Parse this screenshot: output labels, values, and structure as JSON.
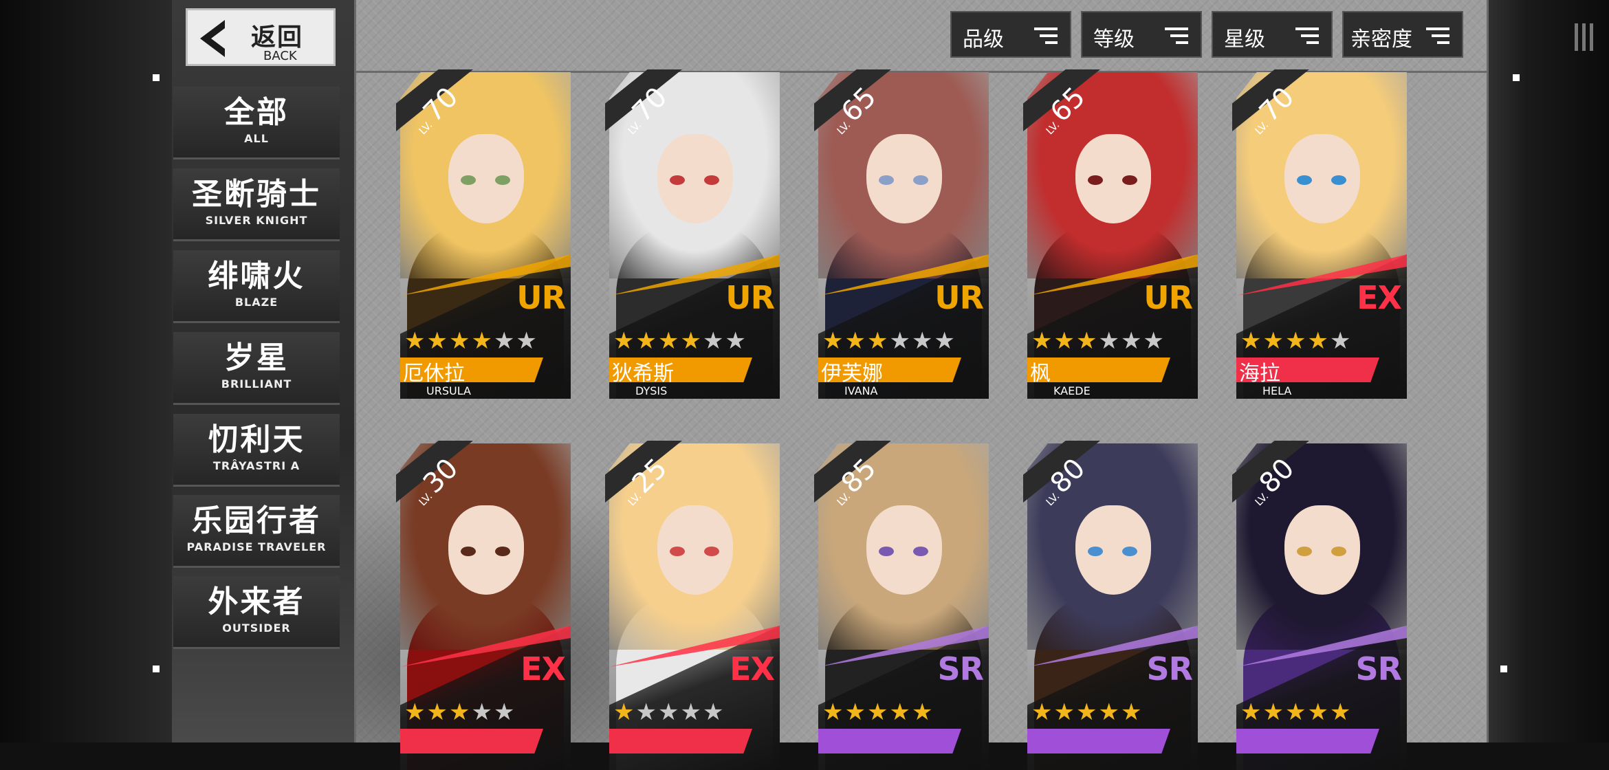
{
  "back": {
    "label": "返回",
    "sub": "BACK"
  },
  "sidebar": {
    "items": [
      {
        "cn": "全部",
        "en": "ALL",
        "active": true
      },
      {
        "cn": "圣断骑士",
        "en": "SILVER KNIGHT"
      },
      {
        "cn": "绯啸火",
        "en": "BLAZE"
      },
      {
        "cn": "岁星",
        "en": "BRILLIANT"
      },
      {
        "cn": "忉利天",
        "en": "TRÂYASTRI A"
      },
      {
        "cn": "乐园行者",
        "en": "PARADISE TRAVELER"
      },
      {
        "cn": "外来者",
        "en": "OUTSIDER"
      }
    ]
  },
  "filters": [
    {
      "label": "品级"
    },
    {
      "label": "等级"
    },
    {
      "label": "星级"
    },
    {
      "label": "亲密度"
    }
  ],
  "level_prefix": "LV.",
  "characters": [
    {
      "name_cn": "厄休拉",
      "name_en": "URSULA",
      "level": "70",
      "rarity": "UR",
      "stars": 4,
      "max_stars": 6,
      "hair": "#f0c462",
      "eyes": "#7ea062",
      "outfit": "#3a2a14"
    },
    {
      "name_cn": "狄希斯",
      "name_en": "DYSIS",
      "level": "70",
      "rarity": "UR",
      "stars": 4,
      "max_stars": 6,
      "hair": "#e6e6e6",
      "eyes": "#c33b3b",
      "outfit": "#2c2c2c"
    },
    {
      "name_cn": "伊芙娜",
      "name_en": "IVANA",
      "level": "65",
      "rarity": "UR",
      "stars": 3,
      "max_stars": 6,
      "hair": "#9e5b54",
      "eyes": "#8aa0c8",
      "outfit": "#1d2238"
    },
    {
      "name_cn": "枫",
      "name_en": "KAEDE",
      "level": "65",
      "rarity": "UR",
      "stars": 3,
      "max_stars": 6,
      "hair": "#c22d2d",
      "eyes": "#7a1d1d",
      "outfit": "#2a1a1a"
    },
    {
      "name_cn": "海拉",
      "name_en": "HELA",
      "level": "70",
      "rarity": "EX",
      "stars": 4,
      "max_stars": 5,
      "hair": "#f5cc7a",
      "eyes": "#3a8fd0",
      "outfit": "#3a3a3a"
    },
    {
      "name_cn": "",
      "name_en": "",
      "level": "30",
      "rarity": "EX",
      "stars": 3,
      "max_stars": 5,
      "hair": "#7a3b24",
      "eyes": "#5a2a1a",
      "outfit": "#8a1010"
    },
    {
      "name_cn": "",
      "name_en": "",
      "level": "25",
      "rarity": "EX",
      "stars": 1,
      "max_stars": 5,
      "hair": "#f6cf8c",
      "eyes": "#d24b4b",
      "outfit": "#e8e8e8"
    },
    {
      "name_cn": "",
      "name_en": "",
      "level": "85",
      "rarity": "SR",
      "stars": 5,
      "max_stars": 5,
      "hair": "#c9a77a",
      "eyes": "#7a5ab0",
      "outfit": "#222222"
    },
    {
      "name_cn": "",
      "name_en": "",
      "level": "80",
      "rarity": "SR",
      "stars": 5,
      "max_stars": 5,
      "hair": "#3d3b5a",
      "eyes": "#4a8fd0",
      "outfit": "#3a2418"
    },
    {
      "name_cn": "",
      "name_en": "",
      "level": "80",
      "rarity": "SR",
      "stars": 5,
      "max_stars": 5,
      "hair": "#1e1830",
      "eyes": "#d0a040",
      "outfit": "#4a2a7a"
    }
  ],
  "colors": {
    "UR": "#f0a400",
    "EX": "#ff3148",
    "SR": "#b07ae0",
    "namebar_UR": "#f09a00",
    "namebar_EX": "#f03048",
    "namebar_SR": "#a04fd8",
    "accent_blue": "#1f5ea0"
  }
}
